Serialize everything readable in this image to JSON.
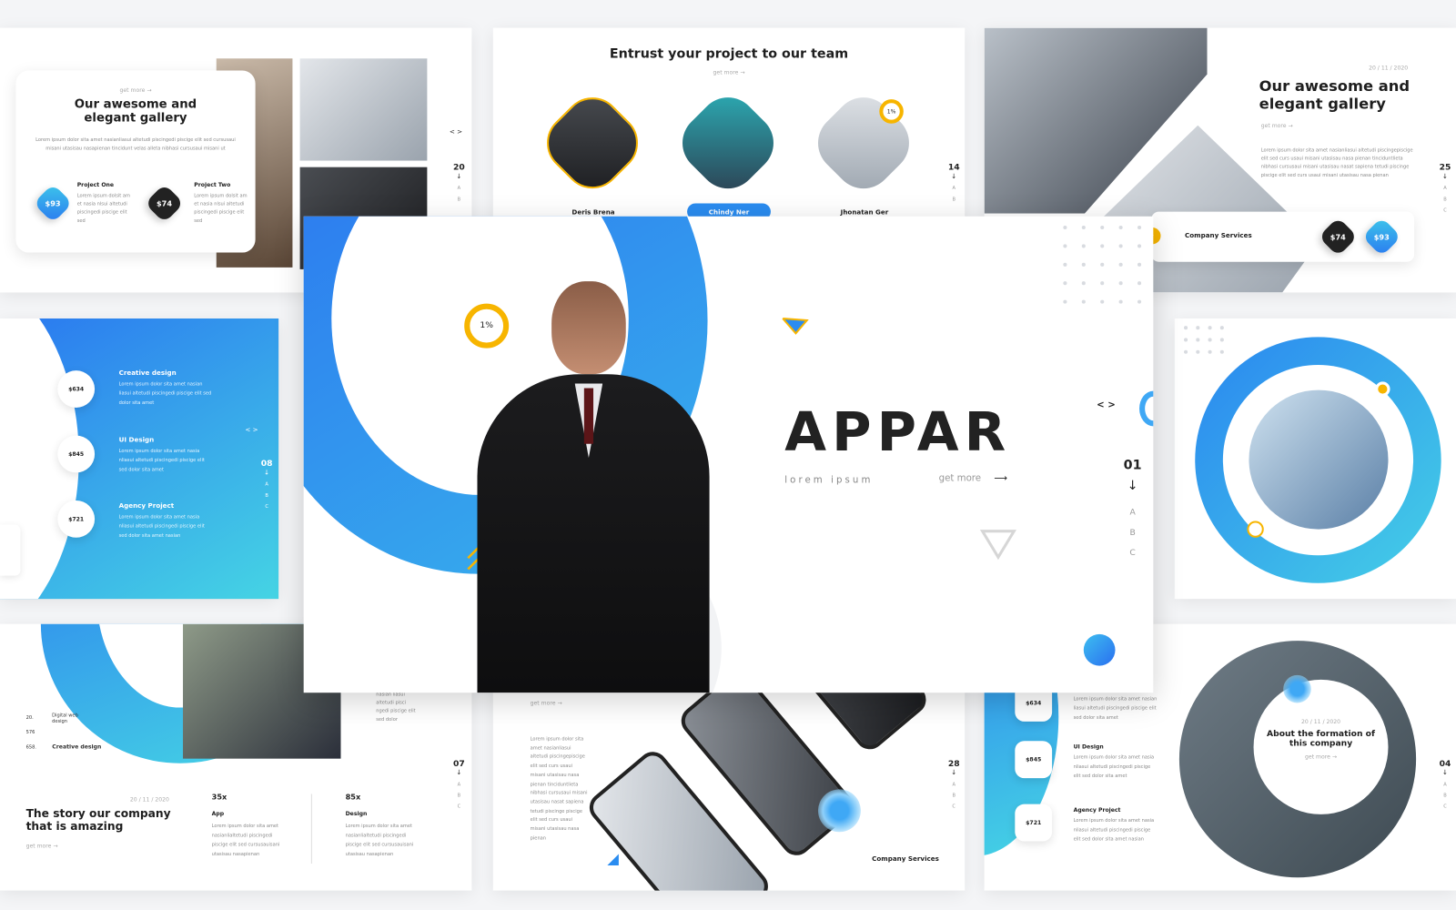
{
  "slides": {
    "gallery_card": {
      "get_more": "get more",
      "title": "Our awesome and elegant gallery",
      "body": "Lorem ipsum dolor sita amet nasianliasui altetudi piscingedi piscige elit sed cursusaui misani utasisau nasapienan tincidunt velas alleta nibhasi cursusaui misani ut",
      "projects": [
        {
          "price": "$93",
          "title": "Project One",
          "body": "Lorem ipsum dolsit am et nasia nlsui altetudi piscingedi piscige elit sed"
        },
        {
          "price": "$74",
          "title": "Project Two",
          "body": "Lorem ipsum dolsit am et nasia nlsui altetudi piscingedi piscige elit sed"
        }
      ],
      "page": "20",
      "nav": "< >",
      "letters": [
        "A",
        "B"
      ]
    },
    "team": {
      "title": "Entrust your project to our team",
      "get_more": "get more",
      "members": [
        "Deris Brena",
        "Chindy Ner",
        "Jhonatan Ger"
      ],
      "badge": "1%",
      "page": "14",
      "letters": [
        "A",
        "B"
      ]
    },
    "gallery_right": {
      "date": "20 / 11 / 2020",
      "title": "Our awesome and elegant gallery",
      "get_more": "get more",
      "body": "Lorem ipsum dolor sita amet nasianliasui altetudi piscingepiscige elit sed curs usaui misani utasisau nasa pienan tinciduntlieta nibhasi cursusaui misani utasisau nasat sapiena tetudi piscinge piscige elit sed curs usaui misani utasisau nasa pienan",
      "services_label": "Company Services",
      "prices": [
        "$74",
        "$93"
      ],
      "page": "25",
      "letters": [
        "A",
        "B",
        "C"
      ]
    },
    "services_blue": {
      "items": [
        {
          "price": "$634",
          "title": "Creative design",
          "body": "Lorem ipsum dolor sita amet nasian liasui altetudi piscingedi piscige elit sed dolor sita amet"
        },
        {
          "price": "$845",
          "title": "UI Design",
          "body": "Lorem ipsum dolor sita amet nasia nliasui altetudi piscingedi piscige elit sed dolor sita amet"
        },
        {
          "price": "$721",
          "title": "Agency Project",
          "body": "Lorem ipsum dolor sita amet nasia nliasui altetudi piscingedi piscige elit sed dolor sita amet nasian"
        }
      ],
      "page": "08",
      "nav": "< >",
      "letters": [
        "A",
        "B",
        "C"
      ]
    },
    "story": {
      "list": [
        {
          "num": "20.",
          "label": "Digital web design"
        },
        {
          "num": "576",
          "label": ""
        },
        {
          "num": "658.",
          "label": "Creative design"
        }
      ],
      "date": "20 / 11 / 2020",
      "title": "The story our company that is amazing",
      "get_more": "get more",
      "stats": [
        {
          "value": "35x",
          "label": "App",
          "body": "Lorem ipsum dolor sita amet nasianliaItetudi piscingedi piscige elit sed cursusauisani utasisau nasapienan"
        },
        {
          "value": "85x",
          "label": "Design",
          "body": "Lorem ipsum dolor sita amet nasianliaItetudi piscingedi piscige elit sed cursusauisani utasisau nasapienan"
        }
      ],
      "side_text": "nasian liasui altetudi pisci ngedi piscige elit sed dolor",
      "page": "07",
      "letters": [
        "A",
        "B",
        "C"
      ]
    },
    "phones": {
      "get_more": "get more",
      "body": "Lorem ipsum dolor sita amet nasianliasui altetudi piscingepiscige elit sed curs usaui misani utasisau nasa pienan tinciduntlieta nibhasi cursusaui misani utasisau nasat sapiena tetudi piscinge piscige elit sed curs usaui misani utasisau nasa pienan",
      "label": "Company Services",
      "page": "28",
      "letters": [
        "A",
        "B",
        "C"
      ]
    },
    "formation": {
      "items": [
        {
          "price": "$634",
          "title": "",
          "body": "Lorem ipsum dolor sita amet nasian liasui altetudi piscingedi piscige elit sed dolor sita amet"
        },
        {
          "price": "$845",
          "title": "UI Design",
          "body": "Lorem ipsum dolor sita amet nasia nliasui altetudi piscingedi piscige elit sed dolor sita amet"
        },
        {
          "price": "$721",
          "title": "Agency Project",
          "body": "Lorem ipsum dolor sita amet nasia nliasui altetudi piscingedi piscige elit sed dolor sita amet nasian"
        }
      ],
      "date": "20 / 11 / 2020",
      "title": "About the formation of this company",
      "get_more": "get more",
      "page": "04",
      "letters": [
        "A",
        "B",
        "C"
      ]
    },
    "hero": {
      "logo": "APPAR",
      "tagline": "lorem ipsum",
      "get_more": "get more",
      "badge": "1%",
      "page": "01",
      "nav": "< >",
      "letters": [
        "A",
        "B",
        "C"
      ]
    }
  },
  "colors": {
    "accent_blue": "#2a7af0",
    "accent_cyan": "#45d2e4",
    "accent_yellow": "#f7b500",
    "text": "#1e1e1e"
  }
}
